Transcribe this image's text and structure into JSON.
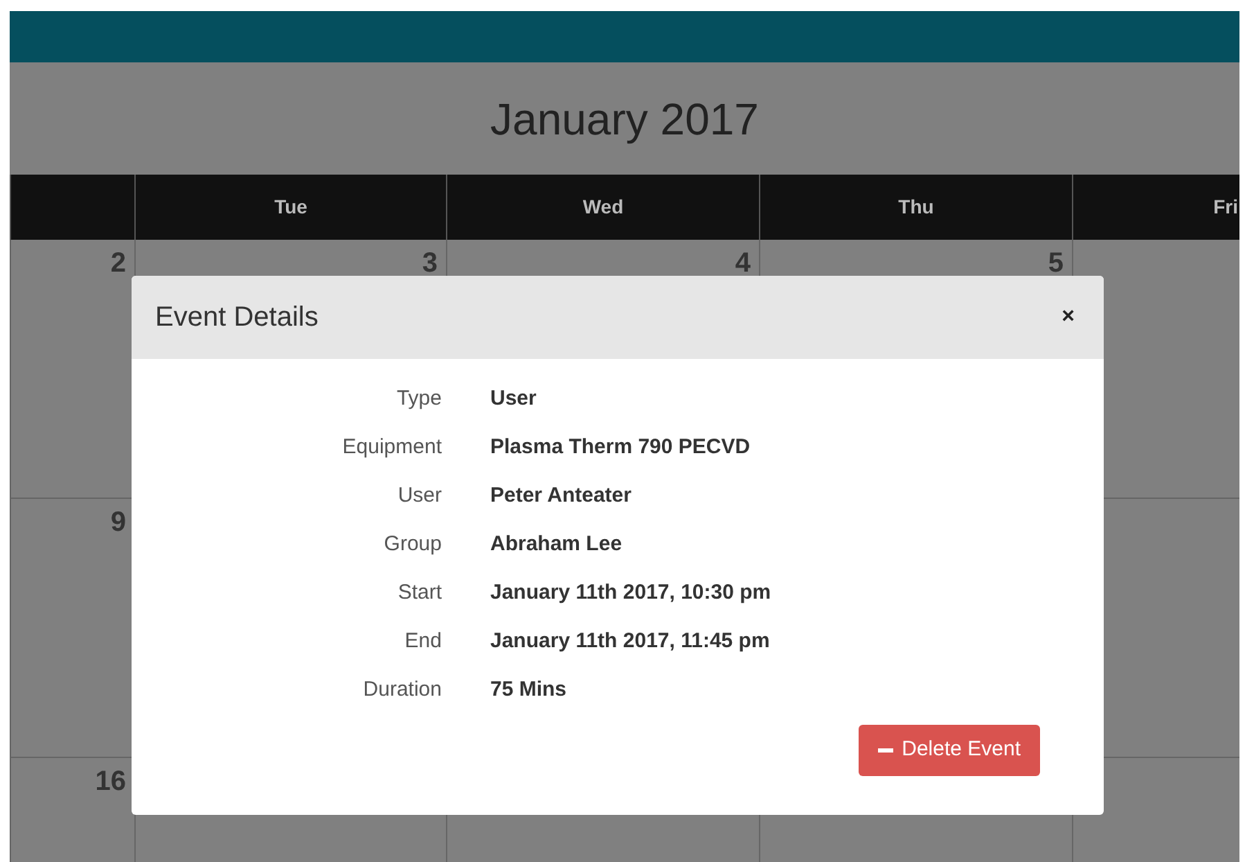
{
  "calendar": {
    "title": "January 2017",
    "columns": [
      "",
      "Tue",
      "Wed",
      "Thu",
      "Fri"
    ],
    "weeks": [
      [
        "2",
        "3",
        "4",
        "5"
      ],
      [
        "9"
      ],
      [
        "16"
      ]
    ]
  },
  "dialog": {
    "title": "Event Details",
    "close": "×",
    "fields": [
      {
        "label": "Type",
        "value": "User"
      },
      {
        "label": "Equipment",
        "value": "Plasma Therm 790 PECVD"
      },
      {
        "label": "User",
        "value": "Peter Anteater"
      },
      {
        "label": "Group",
        "value": "Abraham Lee"
      },
      {
        "label": "Start",
        "value": "January 11th 2017, 10:30 pm"
      },
      {
        "label": "End",
        "value": "January 11th 2017, 11:45 pm"
      },
      {
        "label": "Duration",
        "value": "75 Mins"
      }
    ],
    "button": "Delete Event"
  }
}
